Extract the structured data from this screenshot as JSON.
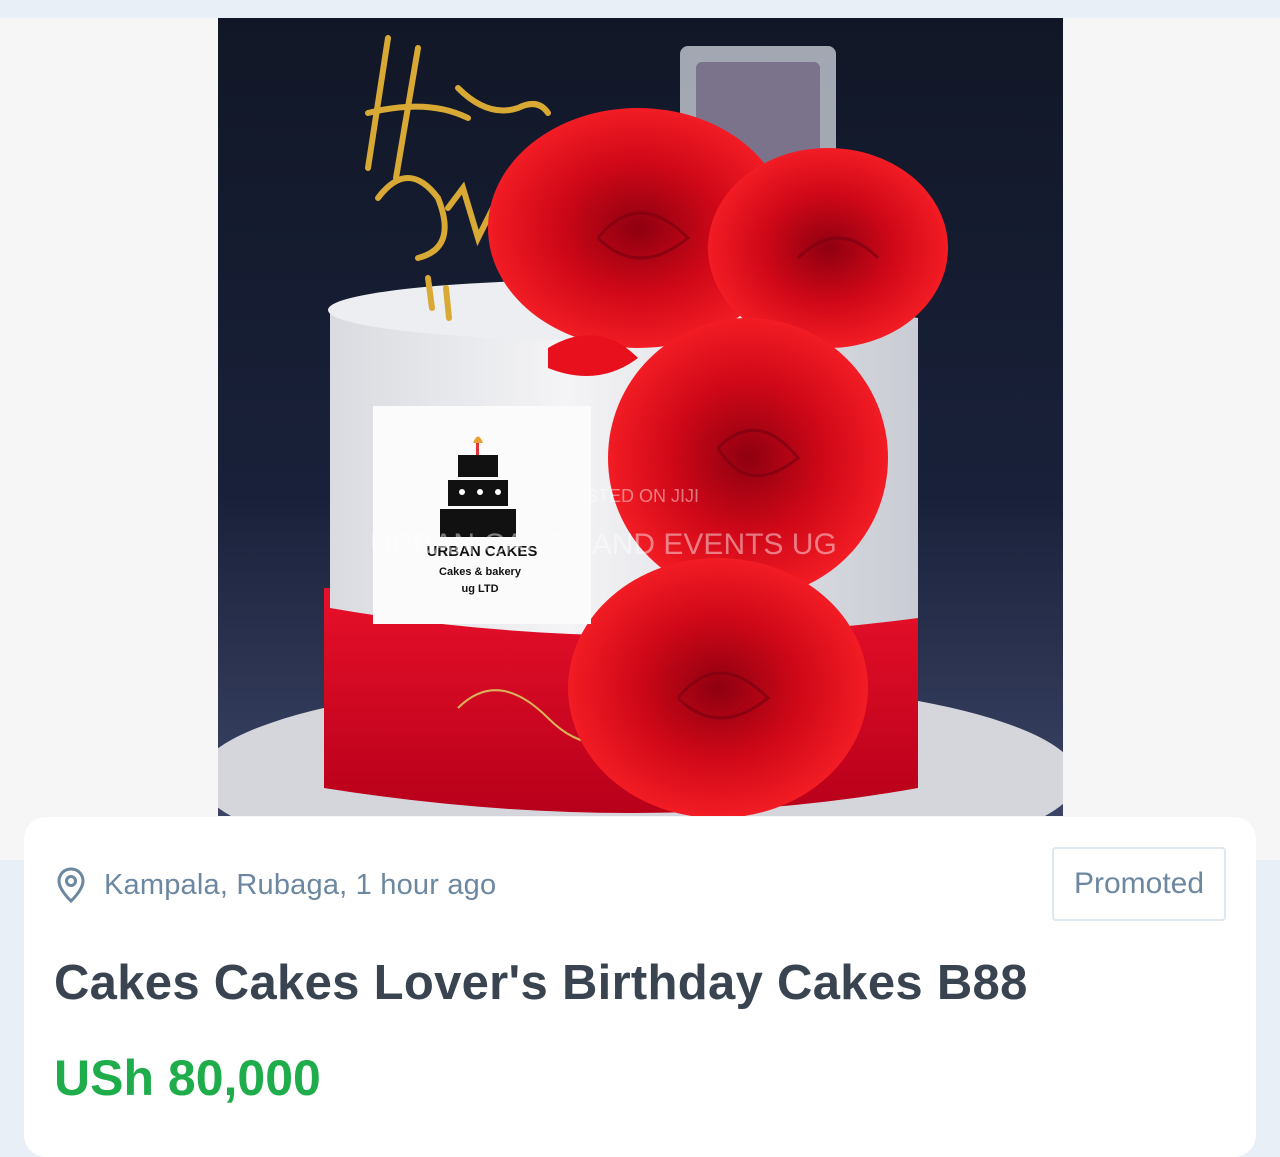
{
  "listing": {
    "location": "Kampala, Rubaga, 1 hour ago",
    "badge": "Promoted",
    "title": "Cakes Cakes Lover's Birthday Cakes B88",
    "price": "USh 80,000"
  },
  "photo": {
    "topper_line1": "Happy",
    "topper_line2": "Birthd",
    "logo_name": "URBAN CAKES",
    "logo_sub1": "Cakes & bakery",
    "logo_sub2": "ug LTD",
    "watermark_top": "POSTED ON JIJI",
    "watermark_main": "URBAN CAKES AND EVENTS UG"
  },
  "icons": {
    "location": "map-pin-icon"
  },
  "colors": {
    "price": "#1fad4b",
    "meta": "#6c87a0",
    "title": "#3a4451",
    "card_bg": "#ffffff",
    "page_bg": "#e9eff7"
  }
}
